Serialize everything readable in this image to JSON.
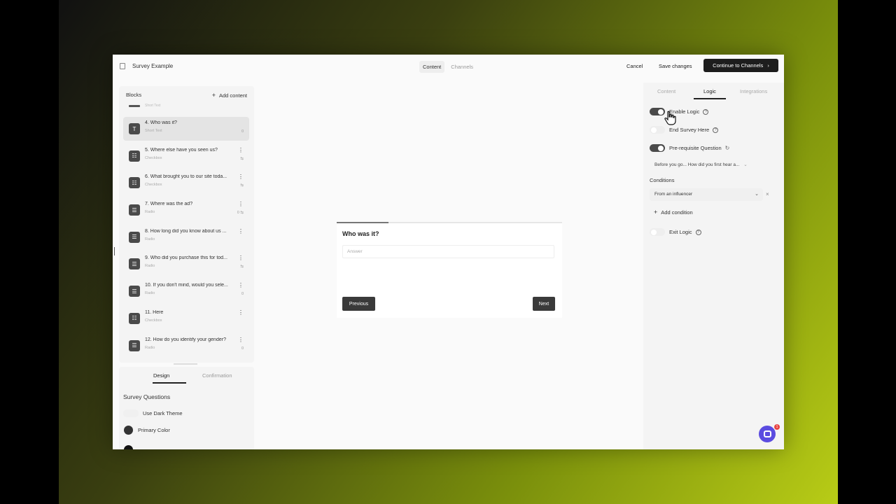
{
  "app": {
    "title": "Survey Example",
    "top_tabs": [
      {
        "label": "Content",
        "active": true
      },
      {
        "label": "Channels",
        "active": false
      }
    ],
    "cancel_label": "Cancel",
    "save_label": "Save changes",
    "continue_label": "Continue to Channels",
    "continue_icon": "chevron-right-icon"
  },
  "blocks_panel": {
    "label": "Blocks",
    "add_content_label": "Add content",
    "partial_item_subtitle": "Short Text",
    "items": [
      {
        "title": "4. Who was it?",
        "subtitle": "Short Text",
        "icon": "text-icon",
        "extra": "0",
        "selected": true
      },
      {
        "title": "5. Where else have you seen us?",
        "subtitle": "Checkbox",
        "icon": "checkbox-icon",
        "extra": "⇆",
        "selected": false
      },
      {
        "title": "6. What brought you to our site toda...",
        "subtitle": "Checkbox",
        "icon": "checkbox-icon",
        "extra": "⇆",
        "selected": false
      },
      {
        "title": "7. Where was the ad?",
        "subtitle": "Radio",
        "icon": "list-icon",
        "extra": "0  ⇆",
        "selected": false
      },
      {
        "title": "8. How long did you know about us ...",
        "subtitle": "Radio",
        "icon": "list-icon",
        "extra": "",
        "selected": false
      },
      {
        "title": "9. Who did you purchase this for tod...",
        "subtitle": "Radio",
        "icon": "list-icon",
        "extra": "⇆",
        "selected": false
      },
      {
        "title": "10. If you don't mind, would you sele...",
        "subtitle": "Radio",
        "icon": "list-icon",
        "extra": "0",
        "selected": false
      },
      {
        "title": "11. Here",
        "subtitle": "Checkbox",
        "icon": "checkbox-icon",
        "extra": "",
        "selected": false
      },
      {
        "title": "12. How do you identify your gender?",
        "subtitle": "Radio",
        "icon": "list-icon",
        "extra": "0",
        "selected": false
      }
    ]
  },
  "design_panel": {
    "tabs": [
      {
        "label": "Design",
        "active": true
      },
      {
        "label": "Confirmation",
        "active": false
      }
    ],
    "section_title": "Survey Questions",
    "dark_theme_label": "Use Dark Theme",
    "dark_theme_on": false,
    "primary_color_label": "Primary Color",
    "primary_color": "#333333"
  },
  "preview": {
    "progress": 0.23,
    "question": "Who was it?",
    "answer_placeholder": "Answer",
    "previous_label": "Previous",
    "next_label": "Next"
  },
  "logic_panel": {
    "tabs": [
      {
        "label": "Content",
        "active": false
      },
      {
        "label": "Logic",
        "active": true
      },
      {
        "label": "Integrations",
        "active": false
      }
    ],
    "enable_logic_label": "Enable Logic",
    "enable_logic_on": true,
    "end_survey_label": "End Survey Here",
    "end_survey_on": false,
    "prereq_label": "Pre-requisite Question",
    "prereq_on": true,
    "prereq_value": "Before you go... How did you first hear a...",
    "conditions_label": "Conditions",
    "condition_value": "From an influencer",
    "add_condition_label": "Add condition",
    "exit_logic_label": "Exit Logic",
    "exit_logic_on": false
  },
  "chat": {
    "badge_count": "1",
    "accent": "#5b4ce0"
  }
}
